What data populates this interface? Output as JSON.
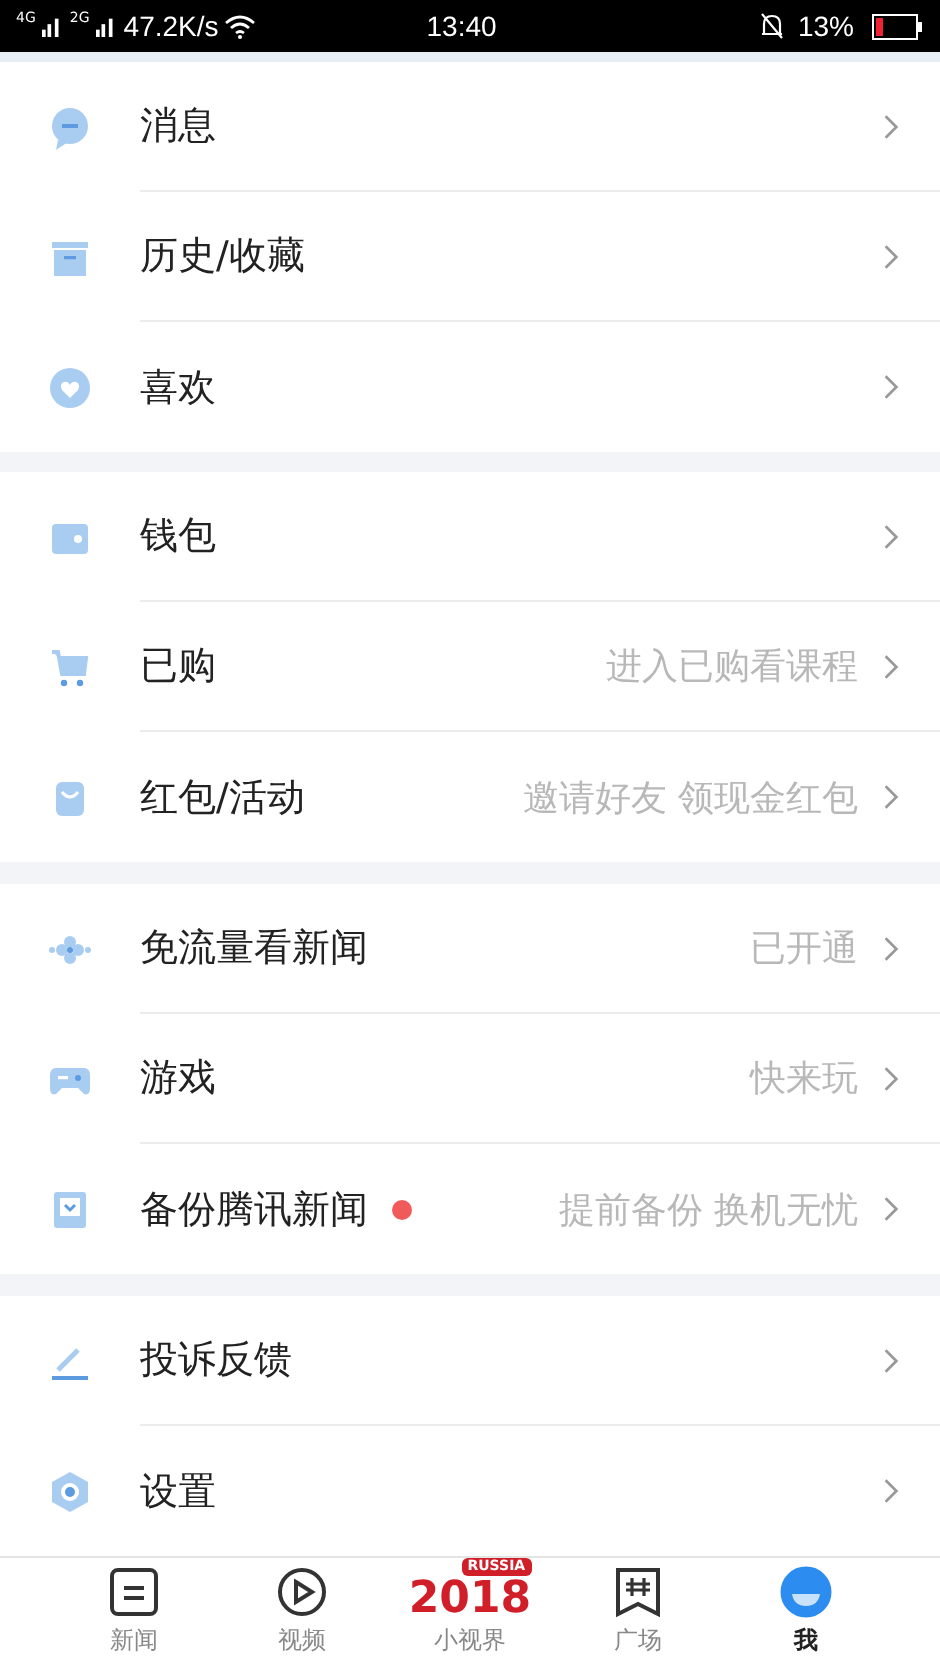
{
  "status_bar": {
    "net1": "4G",
    "net2": "2G",
    "speed": "47.2K/s",
    "time": "13:40",
    "battery": "13%"
  },
  "sections": [
    {
      "rows": [
        {
          "kind": "message",
          "label": "消息",
          "hint": "",
          "dot": false
        },
        {
          "kind": "history",
          "label": "历史/收藏",
          "hint": "",
          "dot": false
        },
        {
          "kind": "like",
          "label": "喜欢",
          "hint": "",
          "dot": false
        }
      ]
    },
    {
      "rows": [
        {
          "kind": "wallet",
          "label": "钱包",
          "hint": "",
          "dot": false
        },
        {
          "kind": "cart",
          "label": "已购",
          "hint": "进入已购看课程",
          "dot": false
        },
        {
          "kind": "bag",
          "label": "红包/活动",
          "hint": "邀请好友 领现金红包",
          "dot": false
        }
      ]
    },
    {
      "rows": [
        {
          "kind": "flower",
          "label": "免流量看新闻",
          "hint": "已开通",
          "dot": false
        },
        {
          "kind": "game",
          "label": "游戏",
          "hint": "快来玩",
          "dot": false
        },
        {
          "kind": "backup",
          "label": "备份腾讯新闻",
          "hint": "提前备份 换机无忧",
          "dot": true
        }
      ]
    },
    {
      "rows": [
        {
          "kind": "pen",
          "label": "投诉反馈",
          "hint": "",
          "dot": false
        },
        {
          "kind": "settings",
          "label": "设置",
          "hint": "",
          "dot": false
        }
      ]
    }
  ],
  "tab_bar": [
    {
      "kind": "news",
      "label": "新闻",
      "selected": false
    },
    {
      "kind": "video",
      "label": "视频",
      "selected": false
    },
    {
      "kind": "logo",
      "label": "小视界",
      "logo_top": "RUSSIA",
      "logo_year": "2018",
      "selected": false
    },
    {
      "kind": "square",
      "label": "广场",
      "selected": false
    },
    {
      "kind": "me",
      "label": "我",
      "selected": true
    }
  ]
}
